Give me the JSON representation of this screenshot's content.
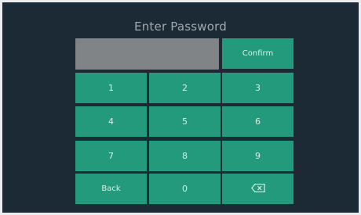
{
  "screen": {
    "title": "Enter Password",
    "password_value": ""
  },
  "keypad": {
    "confirm_label": "Confirm",
    "keys": [
      "1",
      "2",
      "3",
      "4",
      "5",
      "6",
      "7",
      "8",
      "9"
    ],
    "back_label": "Back",
    "zero_label": "0",
    "backspace_icon": "backspace-icon"
  },
  "colors": {
    "background": "#1b2a35",
    "key": "#229a7b",
    "field": "#808487",
    "title_text": "#9fa9b0"
  }
}
